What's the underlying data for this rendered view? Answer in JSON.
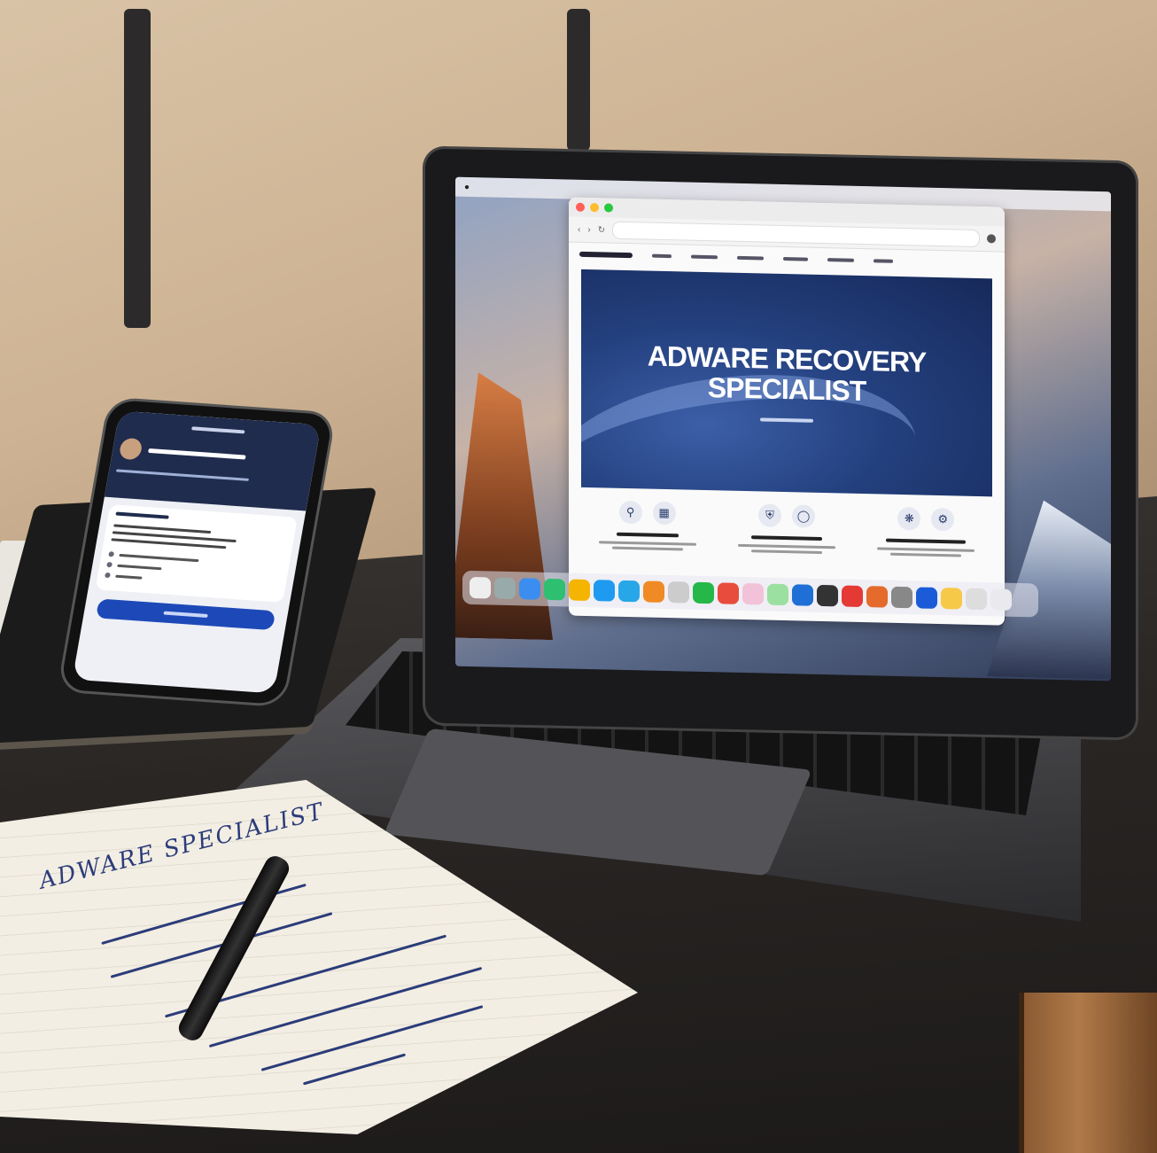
{
  "laptop": {
    "page_title": "ADWARE RECOVERY SPECIALIST"
  },
  "notebook": {
    "line1": "ADWARE SPECIALIST"
  },
  "colors": {
    "hero": "#23407e",
    "button": "#1d49b8",
    "desk": "#2a2624"
  }
}
